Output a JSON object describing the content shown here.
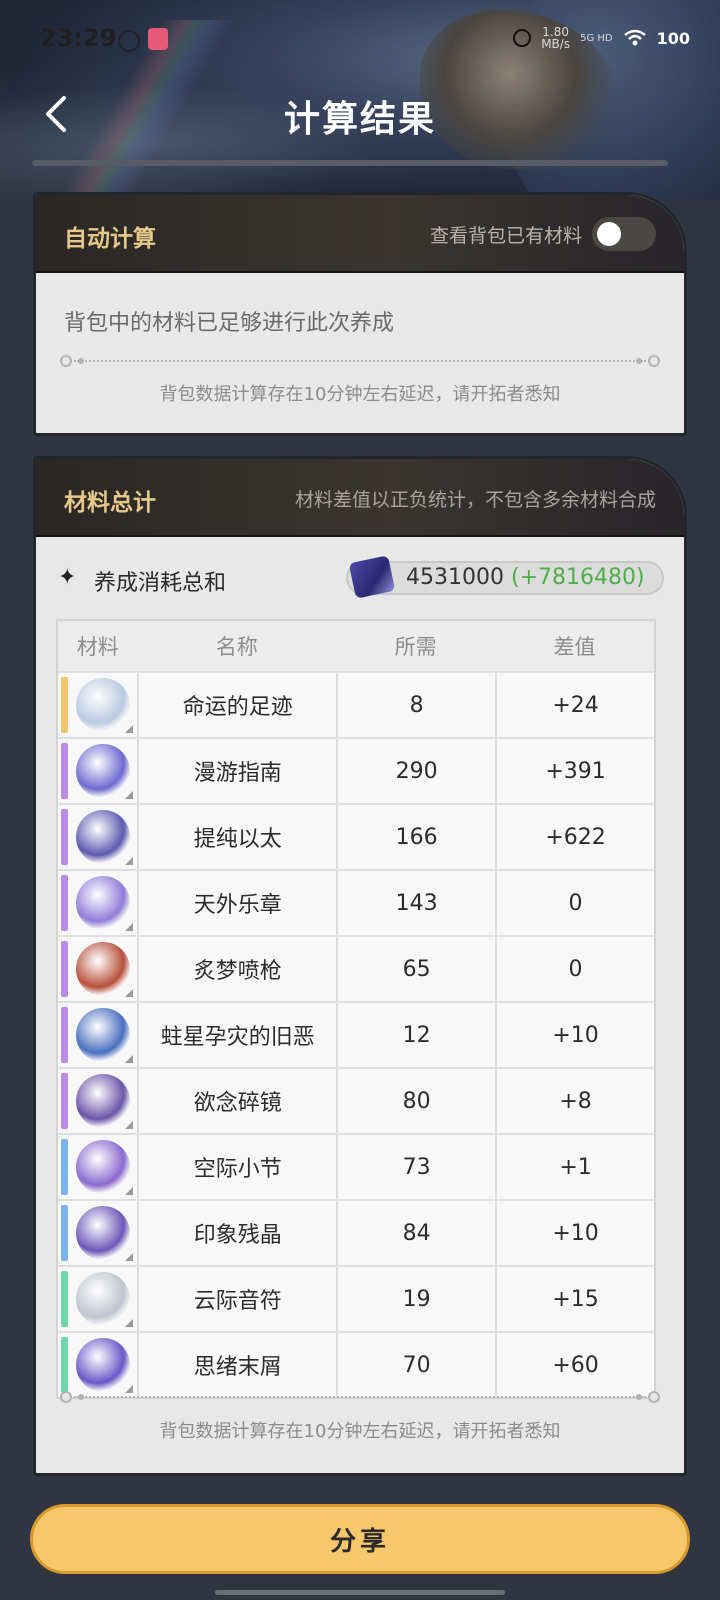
{
  "status_bar": {
    "time": "23:29",
    "speed": "1.80",
    "speed_unit": "MB/s",
    "network": "5G HD",
    "battery": "100"
  },
  "header": {
    "title": "计算结果"
  },
  "auto_calc": {
    "title": "自动计算",
    "toggle_label": "查看背包已有材料",
    "toggle_on": false,
    "message": "背包中的材料已足够进行此次养成",
    "footnote": "背包数据计算存在10分钟左右延迟，请开拓者悉知"
  },
  "totals": {
    "title": "材料总计",
    "note": "材料差值以正负统计，不包含多余材料合成",
    "sum_label": "养成消耗总和",
    "credits": "4531000",
    "credits_diff": "(+7816480)",
    "columns": [
      "材料",
      "名称",
      "所需",
      "差值"
    ],
    "rows": [
      {
        "name": "命运的足迹",
        "required": "8",
        "diff": "+24",
        "rarity_color": "#f4c56a",
        "icon_color": "#b9c9e0",
        "icon": "destiny-footprint-icon"
      },
      {
        "name": "漫游指南",
        "required": "290",
        "diff": "+391",
        "rarity_color": "#bb8bea",
        "icon_color": "#6e6ad0",
        "icon": "travel-guide-icon"
      },
      {
        "name": "提纯以太",
        "required": "166",
        "diff": "+622",
        "rarity_color": "#bb8bea",
        "icon_color": "#5e5ab0",
        "icon": "refined-aether-icon"
      },
      {
        "name": "天外乐章",
        "required": "143",
        "diff": "0",
        "rarity_color": "#bb8bea",
        "icon_color": "#8f7dd8",
        "icon": "celestial-section-icon"
      },
      {
        "name": "炙梦喷枪",
        "required": "65",
        "diff": "0",
        "rarity_color": "#bb8bea",
        "icon_color": "#b8513c",
        "icon": "dream-flamer-icon"
      },
      {
        "name": "蛀星孕灾的旧恶",
        "required": "12",
        "diff": "+10",
        "rarity_color": "#bb8bea",
        "icon_color": "#4a6fc0",
        "icon": "starflare-icon"
      },
      {
        "name": "欲念碎镜",
        "required": "80",
        "diff": "+8",
        "rarity_color": "#bb8bea",
        "icon_color": "#6c55a8",
        "icon": "shattered-mirror-icon"
      },
      {
        "name": "空际小节",
        "required": "73",
        "diff": "+1",
        "rarity_color": "#7ab4ea",
        "icon_color": "#8a6ad0",
        "icon": "void-bar-icon"
      },
      {
        "name": "印象残晶",
        "required": "84",
        "diff": "+10",
        "rarity_color": "#7ab4ea",
        "icon_color": "#6b58b8",
        "icon": "impression-crystal-icon"
      },
      {
        "name": "云际音符",
        "required": "19",
        "diff": "+15",
        "rarity_color": "#6fd6a8",
        "icon_color": "#bfc3d0",
        "icon": "cloud-note-icon"
      },
      {
        "name": "思绪末屑",
        "required": "70",
        "diff": "+60",
        "rarity_color": "#6fd6a8",
        "icon_color": "#6a58c8",
        "icon": "thought-shard-icon"
      }
    ],
    "footnote": "背包数据计算存在10分钟左右延迟，请开拓者悉知"
  },
  "share_label": "分享",
  "colors": {
    "accent": "#f7c76c",
    "positive": "#4fae4a",
    "title_gold": "#e6c98a"
  }
}
